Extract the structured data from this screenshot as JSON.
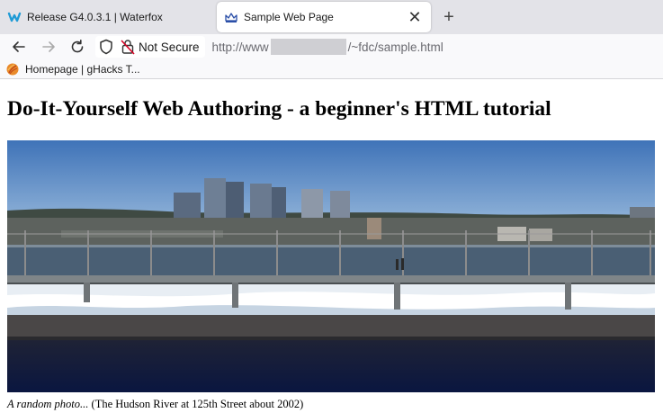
{
  "tabs": [
    {
      "title": "Release G4.0.3.1 | Waterfox",
      "icon": "waterfox-icon",
      "active": false
    },
    {
      "title": "Sample Web Page",
      "icon": "crown-icon",
      "active": true
    }
  ],
  "nav": {
    "security_label": "Not Secure",
    "url_prefix": "http://www",
    "url_suffix": "/~fdc/sample.html"
  },
  "bookmarks": [
    {
      "label": "Homepage | gHacks T...",
      "icon": "ghacks-icon"
    }
  ],
  "page": {
    "heading": "Do-It-Yourself Web Authoring - a beginner's HTML tutorial",
    "caption_italic": "A random photo...",
    "caption_rest": " (The Hudson River at 125th Street about 2002)"
  },
  "colors": {
    "tabstrip": "#e3e3e8",
    "toolbar": "#f9f9fb",
    "sky": "#5d8dc8",
    "water": "#4a5f74",
    "road": "#0d1c3e"
  }
}
